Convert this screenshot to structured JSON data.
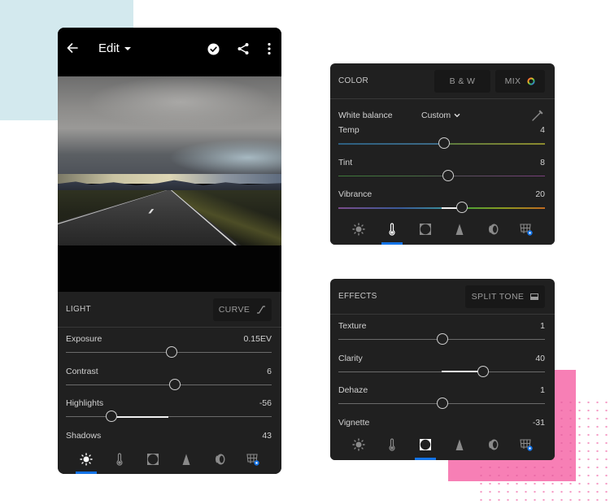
{
  "phone": {
    "topbar": {
      "back_icon": "arrow-left-icon",
      "title": "Edit",
      "title_icon": "caret-down-icon",
      "actions": [
        "check-circle-icon",
        "share-icon",
        "more-vertical-icon"
      ]
    },
    "photo": {
      "description": "Empty wet road under stormy clouds with distant mountains"
    },
    "panel": {
      "section_title": "LIGHT",
      "curve_label": "CURVE",
      "curve_icon": "curve-icon",
      "sliders": [
        {
          "label": "Exposure",
          "value": "0.15EV",
          "position": 0.515
        },
        {
          "label": "Contrast",
          "value": "6",
          "position": 0.53
        },
        {
          "label": "Highlights",
          "value": "-56",
          "position": 0.22
        },
        {
          "label": "Shadows",
          "value": "43",
          "position": null
        }
      ]
    },
    "tabs": [
      {
        "name": "light",
        "icon": "sun-icon",
        "active": true
      },
      {
        "name": "color",
        "icon": "thermometer-icon",
        "active": false
      },
      {
        "name": "effects",
        "icon": "vignette-frame-icon",
        "active": false
      },
      {
        "name": "detail",
        "icon": "triangle-icon",
        "active": false
      },
      {
        "name": "optics",
        "icon": "lens-icon",
        "active": false
      },
      {
        "name": "geometry",
        "icon": "geometry-grid-icon",
        "active": false
      }
    ]
  },
  "color_card": {
    "section_title": "COLOR",
    "bw_label": "B & W",
    "mix_label": "MIX",
    "mix_icon": "color-wheel-icon",
    "white_balance": {
      "label": "White balance",
      "value": "Custom",
      "picker_icon": "eyedropper-icon"
    },
    "sliders": [
      {
        "label": "Temp",
        "value": "4",
        "position": 0.51
      },
      {
        "label": "Tint",
        "value": "8",
        "position": 0.53
      },
      {
        "label": "Vibrance",
        "value": "20",
        "position": 0.6
      }
    ],
    "active_tab": "color"
  },
  "effects_card": {
    "section_title": "EFFECTS",
    "split_tone_label": "SPLIT TONE",
    "split_tone_icon": "split-tone-icon",
    "sliders": [
      {
        "label": "Texture",
        "value": "1",
        "position": 0.505
      },
      {
        "label": "Clarity",
        "value": "40",
        "position": 0.7
      },
      {
        "label": "Dehaze",
        "value": "1",
        "position": 0.505
      },
      {
        "label": "Vignette",
        "value": "-31",
        "position": null
      }
    ],
    "active_tab": "effects"
  },
  "colors": {
    "accent": "#1473e6",
    "panel_bg": "#202020",
    "topbar_bg": "#000000",
    "deco_blue": "#d3e9ee",
    "deco_pink": "#f77fb5"
  }
}
